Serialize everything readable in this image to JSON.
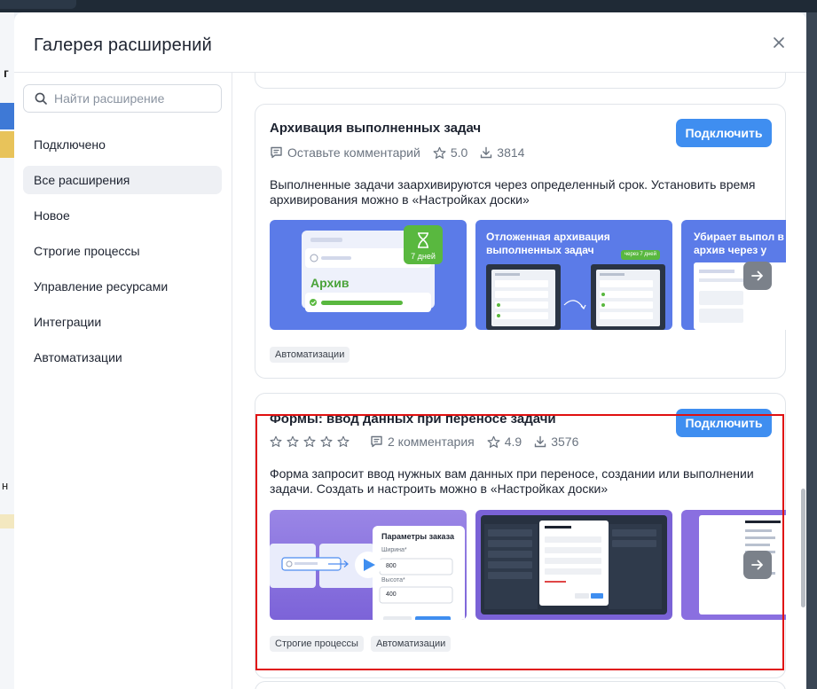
{
  "background": {
    "partial_letters": [
      "г",
      "н"
    ]
  },
  "modal": {
    "title": "Галерея расширений"
  },
  "search": {
    "placeholder": "Найти расширение"
  },
  "sidebar": {
    "items": [
      {
        "label": "Подключено",
        "active": false
      },
      {
        "label": "Все расширения",
        "active": true
      },
      {
        "label": "Новое",
        "active": false
      },
      {
        "label": "Строгие процессы",
        "active": false
      },
      {
        "label": "Управление ресурсами",
        "active": false
      },
      {
        "label": "Интеграции",
        "active": false
      },
      {
        "label": "Автоматизации",
        "active": false
      }
    ]
  },
  "extensions": [
    {
      "title": "Архивация выполненных задач",
      "connect_label": "Подключить",
      "comments": "Оставьте комментарий",
      "rating": "5.0",
      "downloads": "3814",
      "description": "Выполненные задачи заархивируются через определенный срок. Установить время архивирования можно в «Настройках доски»",
      "screens": {
        "s1_badge": "7 дней",
        "s1_label": "Архив",
        "s2_title": "Отложенная архивация выполненных задач",
        "s2_chip": "через 7 дней",
        "s3_title": "Убирает выпол в архив через у"
      },
      "tags": [
        "Автоматизации"
      ]
    },
    {
      "title": "Формы: ввод данных при переносе задачи",
      "connect_label": "Подключить",
      "comments": "2 комментария",
      "rating": "4.9",
      "downloads": "3576",
      "description": "Форма запросит ввод нужных вам данных при переносе, создании или выполнении задачи. Создать и настроить можно в «Настройках доски»",
      "screens": {
        "s1_form_title": "Параметры заказа",
        "s1_field1_label": "Ширина*",
        "s1_field1_value": "800",
        "s1_field2_label": "Высота*",
        "s1_field2_value": "400"
      },
      "tags": [
        "Строгие процессы",
        "Автоматизации"
      ]
    }
  ],
  "colors": {
    "accent": "#3f8ef0",
    "green": "#59b83f",
    "screen_bg": "#5b7be8",
    "purple": "#8a6fe0",
    "highlight": "#e01010"
  }
}
